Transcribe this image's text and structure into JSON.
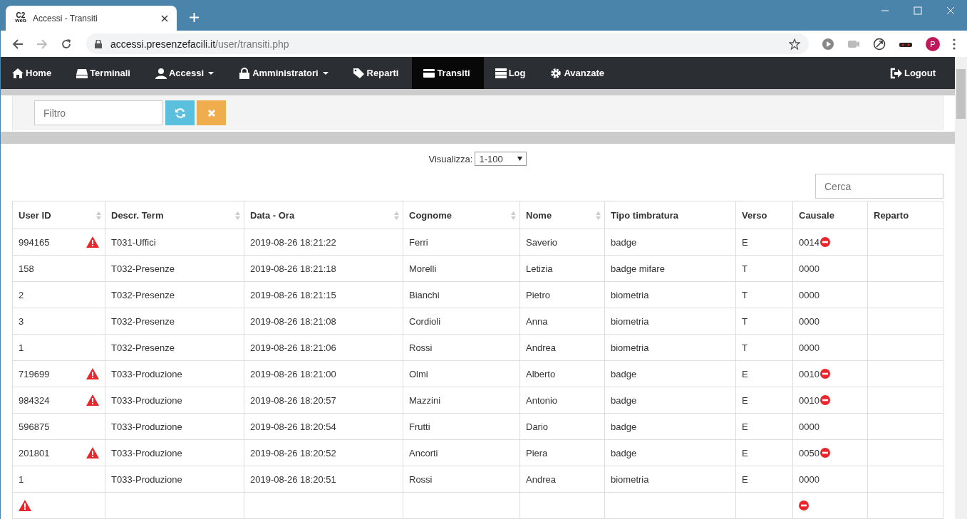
{
  "browser": {
    "tab_title": "Accessi - Transiti",
    "favicon_text": "C2",
    "favicon_sub": "web",
    "url_host": "accessi.presenzefacili.it",
    "url_path": "/user/transiti.php",
    "profile_initial": "P"
  },
  "nav": {
    "items": [
      {
        "label": "Home",
        "caret": false,
        "selected": false
      },
      {
        "label": "Terminali",
        "caret": false,
        "selected": false
      },
      {
        "label": "Accessi",
        "caret": true,
        "selected": false
      },
      {
        "label": "Amministratori",
        "caret": true,
        "selected": false
      },
      {
        "label": "Reparti",
        "caret": false,
        "selected": false
      },
      {
        "label": "Transiti",
        "caret": false,
        "selected": true
      },
      {
        "label": "Log",
        "caret": false,
        "selected": false
      },
      {
        "label": "Avanzate",
        "caret": false,
        "selected": false
      }
    ],
    "logout": "Logout"
  },
  "filter": {
    "placeholder": "Filtro"
  },
  "page_size": {
    "label": "Visualizza:",
    "value": "1-100"
  },
  "search": {
    "placeholder": "Cerca"
  },
  "table": {
    "columns": [
      {
        "label": "User ID",
        "sortable": true
      },
      {
        "label": "Descr. Term",
        "sortable": true
      },
      {
        "label": "Data - Ora",
        "sortable": true
      },
      {
        "label": "Cognome",
        "sortable": true
      },
      {
        "label": "Nome",
        "sortable": true
      },
      {
        "label": "Tipo timbratura",
        "sortable": false
      },
      {
        "label": "Verso",
        "sortable": false
      },
      {
        "label": "Causale",
        "sortable": false
      },
      {
        "label": "Reparto",
        "sortable": false
      }
    ],
    "rows": [
      {
        "cells": [
          "994165",
          "T031-Uffici",
          "2019-08-26 18:21:22",
          "Ferri",
          "Saverio",
          "badge",
          "E",
          "0014"
        ],
        "warning": true,
        "blocked": true
      },
      {
        "cells": [
          "158",
          "T032-Presenze",
          "2019-08-26 18:21:18",
          "Morelli",
          "Letizia",
          "badge mifare",
          "T",
          "0000"
        ],
        "warning": false,
        "blocked": false
      },
      {
        "cells": [
          "2",
          "T032-Presenze",
          "2019-08-26 18:21:15",
          "Bianchi",
          "Pietro",
          "biometria",
          "T",
          "0000"
        ],
        "warning": false,
        "blocked": false
      },
      {
        "cells": [
          "3",
          "T032-Presenze",
          "2019-08-26 18:21:08",
          "Cordioli",
          "Anna",
          "biometria",
          "T",
          "0000"
        ],
        "warning": false,
        "blocked": false
      },
      {
        "cells": [
          "1",
          "T032-Presenze",
          "2019-08-26 18:21:06",
          "Rossi",
          "Andrea",
          "biometria",
          "T",
          "0000"
        ],
        "warning": false,
        "blocked": false
      },
      {
        "cells": [
          "719699",
          "T033-Produzione",
          "2019-08-26 18:21:00",
          "Olmi",
          "Alberto",
          "badge",
          "E",
          "0010"
        ],
        "warning": true,
        "blocked": true
      },
      {
        "cells": [
          "984324",
          "T033-Produzione",
          "2019-08-26 18:20:57",
          "Mazzini",
          "Antonio",
          "badge",
          "E",
          "0010"
        ],
        "warning": true,
        "blocked": true
      },
      {
        "cells": [
          "596875",
          "T033-Produzione",
          "2019-08-26 18:20:54",
          "Frutti",
          "Dario",
          "badge",
          "E",
          "0000"
        ],
        "warning": false,
        "blocked": false
      },
      {
        "cells": [
          "201801",
          "T033-Produzione",
          "2019-08-26 18:20:52",
          "Ancorti",
          "Piera",
          "badge",
          "E",
          "0050"
        ],
        "warning": true,
        "blocked": true
      },
      {
        "cells": [
          "1",
          "T033-Produzione",
          "2019-08-26 18:20:51",
          "Rossi",
          "Andrea",
          "biometria",
          "E",
          "0000"
        ],
        "warning": false,
        "blocked": false
      },
      {
        "cells": [],
        "warning": true,
        "blocked": true
      }
    ]
  }
}
